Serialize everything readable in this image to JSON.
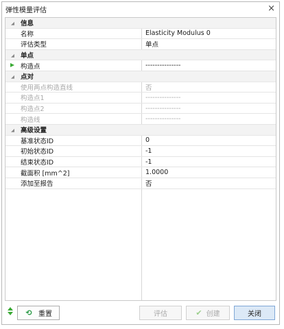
{
  "window": {
    "title": "弹性模量评估",
    "close_glyph": "×"
  },
  "categories": {
    "info": {
      "label": "信息",
      "expander": "◢"
    },
    "single": {
      "label": "单点",
      "expander": "◢"
    },
    "pair": {
      "label": "点对",
      "expander": "◢"
    },
    "advanced": {
      "label": "高级设置",
      "expander": "◢"
    }
  },
  "props": {
    "name": {
      "key": "名称",
      "value": "Elasticity Modulus 0"
    },
    "eval_type": {
      "key": "评估类型",
      "value": "单点"
    },
    "construct_point": {
      "key": "构造点",
      "value": "---------------"
    },
    "use_two_points": {
      "key": "使用两点构造直线",
      "value": "否"
    },
    "construct_point1": {
      "key": "构造点1",
      "value": "---------------"
    },
    "construct_point2": {
      "key": "构造点2",
      "value": "---------------"
    },
    "construct_line": {
      "key": "构造线",
      "value": "---------------"
    },
    "ref_state_id": {
      "key": "基准状态ID",
      "value": "0"
    },
    "init_state_id": {
      "key": "初始状态ID",
      "value": "-1"
    },
    "end_state_id": {
      "key": "结束状态ID",
      "value": "-1"
    },
    "cross_area": {
      "key": "截面积 [mm^2]",
      "value": "1.0000"
    },
    "add_to_report": {
      "key": "添加至报告",
      "value": "否"
    }
  },
  "buttons": {
    "reset": "重置",
    "evaluate": "评估",
    "create": "创建",
    "close": "关闭"
  },
  "colors": {
    "accent_green": "#3aaa35",
    "primary_button": "#dce9f7"
  }
}
